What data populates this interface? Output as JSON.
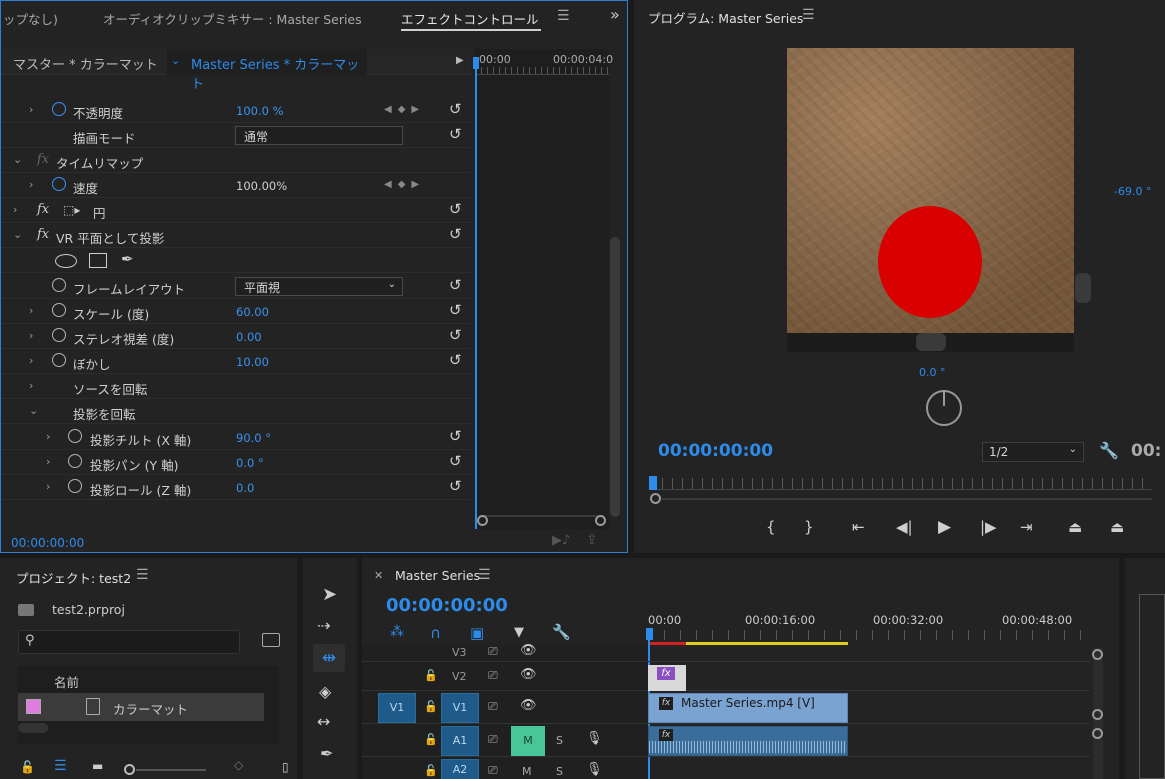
{
  "effect_panel": {
    "tabs": [
      "ップなし)",
      "オーディオクリップミキサー : Master Series",
      "エフェクトコントロール"
    ],
    "master_label": "マスター * カラーマット",
    "clip_label": "Master Series * カラーマット",
    "timeline_start": "00:00",
    "timeline_end": "00:00:04:0",
    "rows": {
      "opacity": {
        "label": "不透明度",
        "value": "100.0 %"
      },
      "blend_mode": {
        "label": "描画モード",
        "value": "通常"
      },
      "time_remap": {
        "label": "タイムリマップ"
      },
      "speed": {
        "label": "速度",
        "value": "100.00%"
      },
      "circle": {
        "label": "円"
      },
      "vr_plane": {
        "label": "VR 平面として投影"
      },
      "frame_layout": {
        "label": "フレームレイアウト",
        "value": "平面視"
      },
      "scale": {
        "label": "スケール (度)",
        "value": "60.00"
      },
      "stereo": {
        "label": "ステレオ視差 (度)",
        "value": "0.00"
      },
      "blur": {
        "label": "ぼかし",
        "value": "10.00"
      },
      "rotate_source": {
        "label": "ソースを回転"
      },
      "rotate_projection": {
        "label": "投影を回転"
      },
      "tilt": {
        "label": "投影チルト (X 軸)",
        "value": "90.0 °"
      },
      "pan": {
        "label": "投影パン (Y 軸)",
        "value": "0.0 °"
      },
      "roll": {
        "label": "投影ロール (Z 軸)",
        "value": "0.0"
      }
    },
    "timecode": "00:00:00:00"
  },
  "program": {
    "title": "プログラム: Master Series",
    "right_angle": "-69.0 °",
    "bottom_angle": "0.0 °",
    "timecode": "00:00:00:00",
    "resolution": "1/2",
    "right_timecode": "00:",
    "colors": {
      "circle": "#d80000",
      "dirt": "#8a6a4c",
      "timecode": "#2d8ceb"
    }
  },
  "project": {
    "title": "プロジェクト: test2",
    "file": "test2.prproj",
    "search_placeholder": "",
    "column_name": "名前",
    "item_name": "カラーマット",
    "item_color": "#e07be0"
  },
  "timeline": {
    "title": "Master Series",
    "timecode": "00:00:00:00",
    "ruler": [
      "00:00",
      "00:00:16:00",
      "00:00:32:00",
      "00:00:48:00"
    ],
    "tracks": {
      "v3": "V3",
      "v2": "V2",
      "v1": "V1",
      "v1_src": "V1",
      "a1": "A1",
      "a2": "A2",
      "m": "M",
      "s": "S"
    },
    "clips": {
      "video": "Master Series.mp4 [V]",
      "fx": "fx"
    }
  }
}
